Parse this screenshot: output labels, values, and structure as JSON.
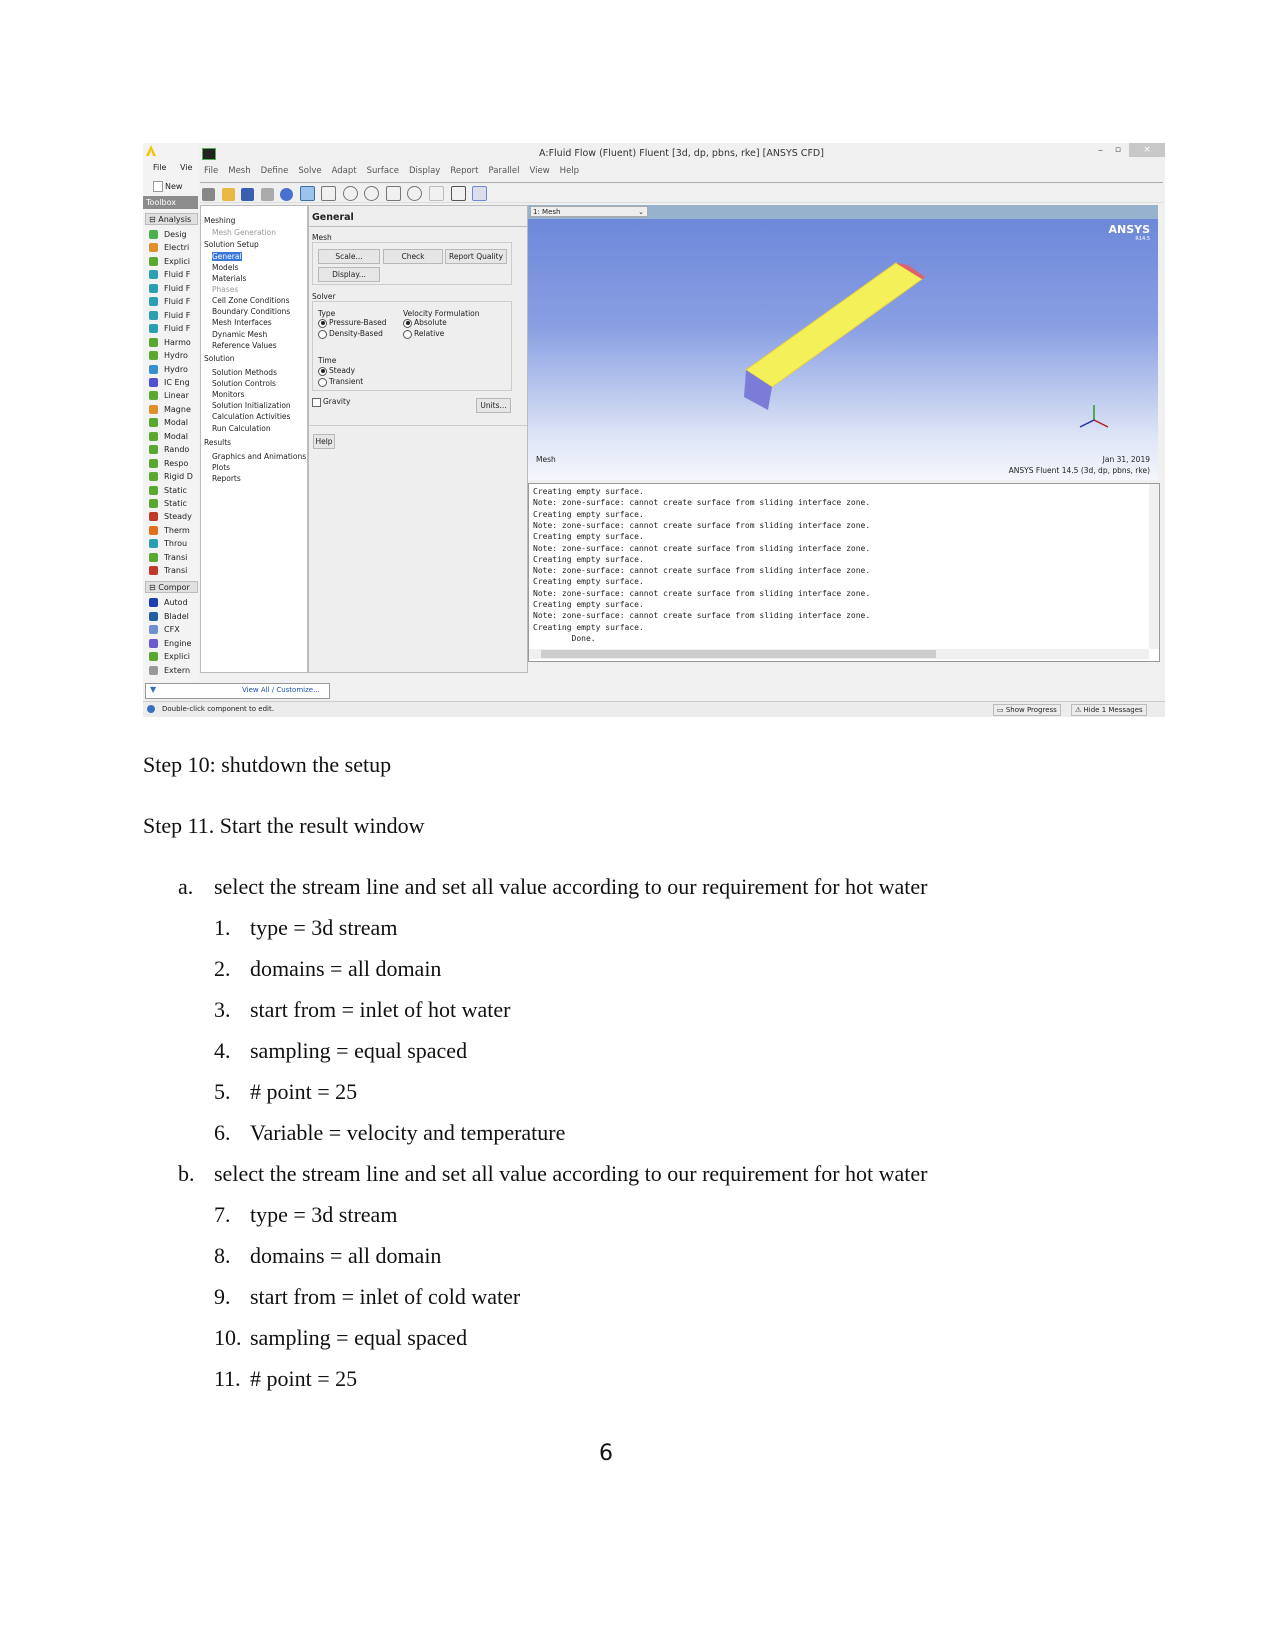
{
  "screenshot": {
    "workbench": {
      "menu": [
        "File",
        "Vie"
      ],
      "new_label": "New",
      "toolbox_label": "Toolbox",
      "analysis_header": "Analysis",
      "analysis_items": [
        "Desig",
        "Electri",
        "Explici",
        "Fluid F",
        "Fluid F",
        "Fluid F",
        "Fluid F",
        "Fluid F",
        "Harmo",
        "Hydro",
        "Hydro",
        "IC Eng",
        "Linear",
        "Magne",
        "Modal",
        "Modal",
        "Rando",
        "Respo",
        "Rigid D",
        "Static",
        "Static",
        "Steady",
        "Therm",
        "Throu",
        "Transi",
        "Transi"
      ],
      "analysis_icon_colors": [
        "#4caf50",
        "#e0902a",
        "#5aa830",
        "#2aa0b0",
        "#2aa0b0",
        "#2aa0b0",
        "#2aa0b0",
        "#2aa0b0",
        "#5aa830",
        "#5aa830",
        "#3a8fd0",
        "#5050d0",
        "#5aa830",
        "#e0902a",
        "#5aa830",
        "#5aa830",
        "#5aa830",
        "#5aa830",
        "#5aa830",
        "#5aa830",
        "#5aa830",
        "#c0392b",
        "#e07020",
        "#2aa0b0",
        "#5aa830",
        "#c0392b"
      ],
      "component_header": "Compor",
      "component_items": [
        "Autod",
        "Bladel",
        "CFX",
        "Engine",
        "Explici",
        "Extern"
      ],
      "component_icon_colors": [
        "#1e3fb0",
        "#2060a0",
        "#7090d0",
        "#6a5acd",
        "#5aa830",
        "#999999"
      ],
      "view_all_link": "View All / Customize...",
      "status_text": "Double-click component to edit.",
      "show_progress": "Show Progress",
      "hide_messages": "Hide 1 Messages"
    },
    "fluent": {
      "title": "A:Fluid Flow (Fluent) Fluent  [3d, dp, pbns, rke] [ANSYS CFD]",
      "menu": [
        "File",
        "Mesh",
        "Define",
        "Solve",
        "Adapt",
        "Surface",
        "Display",
        "Report",
        "Parallel",
        "View",
        "Help"
      ],
      "tree": [
        {
          "label": "Meshing",
          "level": 0,
          "state": "normal"
        },
        {
          "label": "Mesh Generation",
          "level": 1,
          "state": "disabled"
        },
        {
          "label": "Solution Setup",
          "level": 0,
          "state": "normal"
        },
        {
          "label": "General",
          "level": 1,
          "state": "selected"
        },
        {
          "label": "Models",
          "level": 1,
          "state": "normal"
        },
        {
          "label": "Materials",
          "level": 1,
          "state": "normal"
        },
        {
          "label": "Phases",
          "level": 1,
          "state": "disabled"
        },
        {
          "label": "Cell Zone Conditions",
          "level": 1,
          "state": "normal"
        },
        {
          "label": "Boundary Conditions",
          "level": 1,
          "state": "normal"
        },
        {
          "label": "Mesh Interfaces",
          "level": 1,
          "state": "normal"
        },
        {
          "label": "Dynamic Mesh",
          "level": 1,
          "state": "normal"
        },
        {
          "label": "Reference Values",
          "level": 1,
          "state": "normal"
        },
        {
          "label": "Solution",
          "level": 0,
          "state": "normal"
        },
        {
          "label": "Solution Methods",
          "level": 1,
          "state": "normal"
        },
        {
          "label": "Solution Controls",
          "level": 1,
          "state": "normal"
        },
        {
          "label": "Monitors",
          "level": 1,
          "state": "normal"
        },
        {
          "label": "Solution Initialization",
          "level": 1,
          "state": "normal"
        },
        {
          "label": "Calculation Activities",
          "level": 1,
          "state": "normal"
        },
        {
          "label": "Run Calculation",
          "level": 1,
          "state": "normal"
        },
        {
          "label": "Results",
          "level": 0,
          "state": "normal"
        },
        {
          "label": "Graphics and Animations",
          "level": 1,
          "state": "normal"
        },
        {
          "label": "Plots",
          "level": 1,
          "state": "normal"
        },
        {
          "label": "Reports",
          "level": 1,
          "state": "normal"
        }
      ],
      "task": {
        "heading": "General",
        "mesh_label": "Mesh",
        "scale": "Scale...",
        "check": "Check",
        "report_quality": "Report Quality",
        "display": "Display...",
        "solver_label": "Solver",
        "type_label": "Type",
        "pressure_based": "Pressure-Based",
        "density_based": "Density-Based",
        "type_selected": "Pressure-Based",
        "velocity_label": "Velocity Formulation",
        "absolute": "Absolute",
        "relative": "Relative",
        "velocity_selected": "Absolute",
        "time_label": "Time",
        "steady": "Steady",
        "transient": "Transient",
        "time_selected": "Steady",
        "gravity": "Gravity",
        "gravity_checked": false,
        "units": "Units...",
        "help": "Help"
      },
      "graphics": {
        "window_select": "1: Mesh",
        "logo": "ANSYS",
        "logo_version": "R14.5",
        "caption": "Mesh",
        "date": "Jan 31, 2019",
        "version_info": "ANSYS Fluent 14.5 (3d, dp, pbns, rke)",
        "mesh_color": "#f3f05a"
      },
      "console": [
        "Creating empty surface.",
        "Note: zone-surface: cannot create surface from sliding interface zone.",
        "Creating empty surface.",
        "Note: zone-surface: cannot create surface from sliding interface zone.",
        "Creating empty surface.",
        "Note: zone-surface: cannot create surface from sliding interface zone.",
        "Creating empty surface.",
        "Note: zone-surface: cannot create surface from sliding interface zone.",
        "Creating empty surface.",
        "Note: zone-surface: cannot create surface from sliding interface zone.",
        "Creating empty surface.",
        "Note: zone-surface: cannot create surface from sliding interface zone.",
        "Creating empty surface.",
        "        Done."
      ]
    }
  },
  "document": {
    "step10": "Step 10: shutdown the setup",
    "step11": "Step 11. Start the result window",
    "sections": [
      {
        "marker": "a.",
        "text": "select the stream line and set all value according to our requirement  for hot water",
        "items": [
          {
            "n": "1.",
            "t": "type = 3d stream"
          },
          {
            "n": "2.",
            "t": "domains = all domain"
          },
          {
            "n": "3.",
            "t": "start from = inlet of hot water"
          },
          {
            "n": "4.",
            "t": "sampling = equal spaced"
          },
          {
            "n": "5.",
            "t": "# point = 25"
          },
          {
            "n": "6.",
            "t": "Variable = velocity and temperature"
          }
        ]
      },
      {
        "marker": "b.",
        "text": "select the stream line and set all value according to our requirement  for hot water",
        "items": [
          {
            "n": "7.",
            "t": "type = 3d stream"
          },
          {
            "n": "8.",
            "t": "domains = all domain"
          },
          {
            "n": "9.",
            "t": "start from = inlet of cold  water"
          },
          {
            "n": "10.",
            "t": "sampling = equal spaced"
          },
          {
            "n": "11.",
            "t": "# point = 25"
          }
        ]
      }
    ],
    "page_number": "6"
  }
}
